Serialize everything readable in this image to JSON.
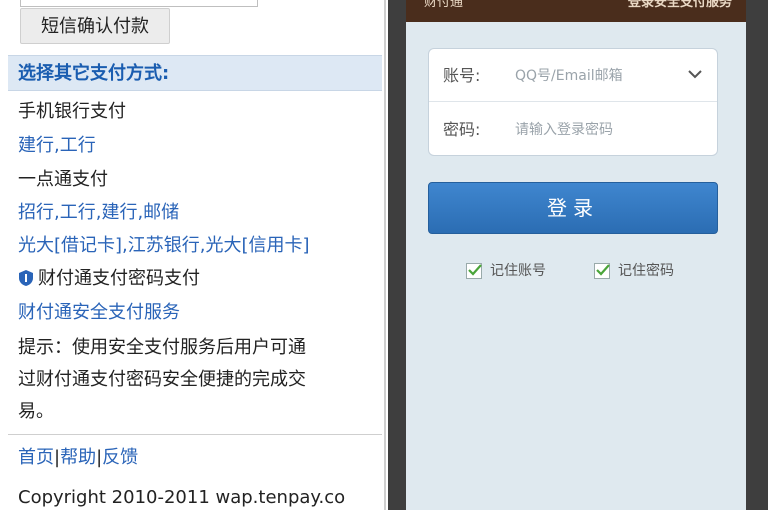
{
  "left": {
    "sms_confirm_label": "短信确认付款",
    "section_header": "选择其它支付方式:",
    "mobile_bank_title": "手机银行支付",
    "mobile_bank_links": "建行,工行",
    "onepass_title": "一点通支付",
    "onepass_links_1": "招行,工行,建行,邮储",
    "onepass_links_2": "光大[借记卡],江苏银行,光大[信用卡]",
    "tenpay_pwd_title": "财付通支付密码支付",
    "tenpay_secure_link": "财付通安全支付服务",
    "tip_line_1": "提示：使用安全支付服务后用户可通",
    "tip_line_2": "过财付通支付密码安全便捷的完成交",
    "tip_line_3": "易。",
    "footer": {
      "home": "首页",
      "help": "帮助",
      "feedback": "反馈",
      "sep": "|"
    },
    "copyright": "Copyright 2010-2011 wap.tenpay.co"
  },
  "phone": {
    "header_brand": "财付通",
    "header_title": "登录安全支付服务",
    "account_label": "账号:",
    "account_placeholder": "QQ号/Email邮箱",
    "password_label": "密码:",
    "password_placeholder": "请输入登录密码",
    "login_label": "登录",
    "remember_account": "记住账号",
    "remember_password": "记住密码"
  },
  "colors": {
    "link": "#2a64b8",
    "button": "#2b6db3",
    "header": "#4a2d1c"
  }
}
